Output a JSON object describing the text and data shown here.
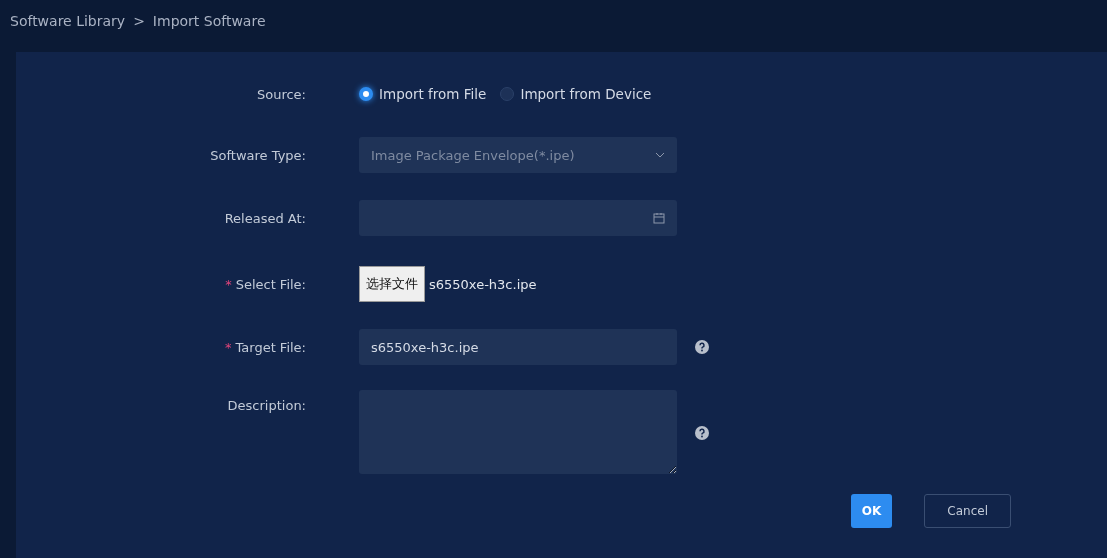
{
  "breadcrumb": [
    {
      "label": "Software Library"
    },
    {
      "label": ">"
    },
    {
      "label": "Import Software"
    }
  ],
  "fields": [
    {
      "kind": "radio",
      "label": "Source:",
      "options": [
        {
          "label": "Import from File",
          "selected": true
        },
        {
          "label": "Import from Device",
          "selected": false
        }
      ]
    },
    {
      "kind": "select",
      "label": "Software Type:",
      "value": "Image Package Envelope(*.ipe)",
      "disabled": true
    },
    {
      "kind": "date",
      "label": "Released At:"
    },
    {
      "kind": "file",
      "label": "Select File:",
      "required_mark": "*",
      "button": "选择文件",
      "value": "s6550xe-h3c.ipe"
    },
    {
      "kind": "text",
      "label": "Target File:",
      "required_mark": "*",
      "value": "s6550xe-h3c.ipe",
      "help": true
    },
    {
      "kind": "textarea",
      "label": "Description:",
      "help": true
    }
  ],
  "buttons": [
    {
      "label": "OK",
      "primary": true
    },
    {
      "label": "Cancel",
      "primary": false
    }
  ]
}
